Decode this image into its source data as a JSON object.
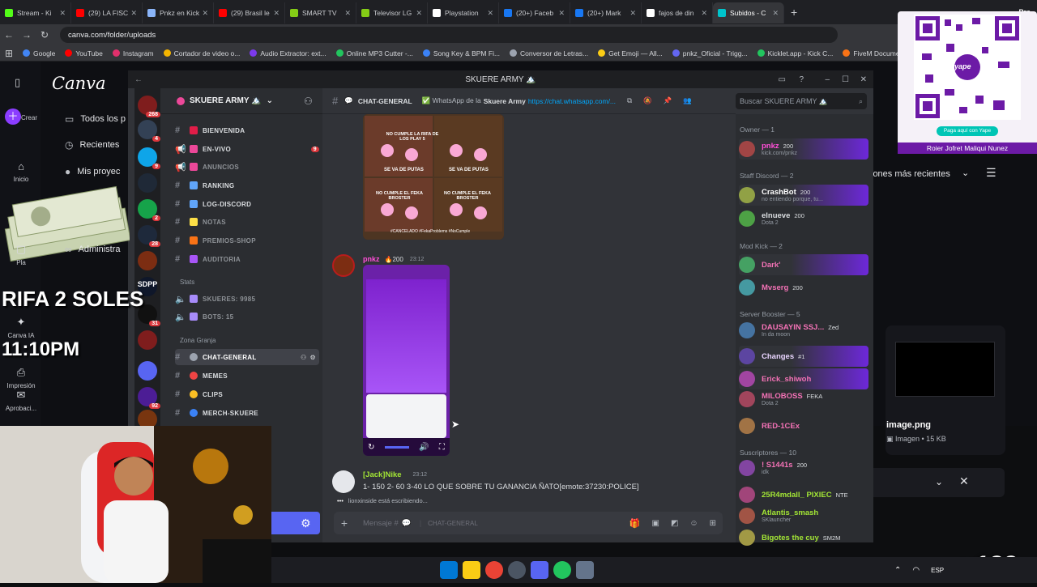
{
  "browser": {
    "tabs": [
      {
        "label": "Stream - Ki",
        "color": "#53fc18"
      },
      {
        "label": "(29) LA FISC",
        "color": "#ff0000"
      },
      {
        "label": "Pnkz en Kick",
        "color": "#8ab4f8"
      },
      {
        "label": "(29) Brasil le",
        "color": "#ff0000"
      },
      {
        "label": "SMART TV",
        "color": "#84cc16"
      },
      {
        "label": "Televisor LG",
        "color": "#84cc16"
      },
      {
        "label": "Playstation",
        "color": "#ffffff"
      },
      {
        "label": "(20+) Faceb",
        "color": "#1877f2"
      },
      {
        "label": "(20+) Mark",
        "color": "#1877f2"
      },
      {
        "label": "fajos de din",
        "color": "#ffffff"
      },
      {
        "label": "Subidos - C",
        "color": "#00c4cc",
        "active": true
      }
    ],
    "new_tab": "+",
    "profile_label": "Pre",
    "url": "canva.com/folder/uploads",
    "bookmarks": [
      {
        "label": "Google",
        "color": "#4285f4"
      },
      {
        "label": "YouTube",
        "color": "#ff0000"
      },
      {
        "label": "Instagram",
        "color": "#e1306c"
      },
      {
        "label": "Cortador de video o...",
        "color": "#f4b400"
      },
      {
        "label": "Audio Extractor: ext...",
        "color": "#7c3aed"
      },
      {
        "label": "Online MP3 Cutter -...",
        "color": "#22c55e"
      },
      {
        "label": "Song Key & BPM Fi...",
        "color": "#3b82f6"
      },
      {
        "label": "Conversor de Letras...",
        "color": "#9ca3af"
      },
      {
        "label": "Get Emoji — All...",
        "color": "#facc15"
      },
      {
        "label": "pnkz_Oficial - Trigg...",
        "color": "#6366f1"
      },
      {
        "label": "Kicklet.app - Kick C...",
        "color": "#22c55e"
      },
      {
        "label": "FiveM Documentat",
        "color": "#f97316"
      }
    ]
  },
  "canva": {
    "logo": "Canva",
    "rail": [
      {
        "label": "Crear",
        "icon": "plus-icon"
      },
      {
        "label": "Inicio",
        "icon": "home-icon"
      },
      {
        "label": "Pla",
        "icon": "folder-icon"
      },
      {
        "label": "Canva IA",
        "icon": "sparkle-icon"
      },
      {
        "label": "Impresión",
        "icon": "print-icon"
      },
      {
        "label": "Aprobaci...",
        "icon": "approval-icon"
      }
    ],
    "menu": [
      {
        "label": "Todos los p",
        "icon": "folder-icon"
      },
      {
        "label": "Recientes",
        "icon": "clock-icon"
      },
      {
        "label": "Mis proyec",
        "icon": "avatar-icon"
      },
      {
        "label": "Administra",
        "icon": "link-icon"
      }
    ],
    "sort_label": "iones más recientes",
    "file": {
      "name": "image.png",
      "meta": "Imagen • 15 KB"
    }
  },
  "overlay": {
    "rifa": "RIFA 2 SOLES",
    "clock": "11:10PM",
    "yape_cta": "Paga aquí con Yape",
    "yape_name": "Roier Jofret Maliqui Nunez",
    "counter": "x123",
    "brand": "yape"
  },
  "discord": {
    "title": "SKUERE ARMY 🏔️",
    "server_name": "SKUERE ARMY 🏔️",
    "guild_badges": [
      "268",
      "4",
      "9",
      "2",
      "28",
      "31",
      "92"
    ],
    "guild_label": "SDPP",
    "channels": [
      {
        "name": "BIENVENIDA",
        "icon": "hash",
        "emoji": "#e11d48"
      },
      {
        "name": "EN-VIVO",
        "icon": "megaphone",
        "emoji": "#ec4899",
        "badge": "9"
      },
      {
        "name": "ANUNCIOS",
        "icon": "megaphone",
        "emoji": "#ec4899",
        "dim": true
      },
      {
        "name": "RANKING",
        "icon": "hash",
        "emoji": "#60a5fa"
      },
      {
        "name": "LOG-DISCORD",
        "icon": "hash",
        "emoji": "#60a5fa"
      },
      {
        "name": "NOTAS",
        "icon": "hash",
        "emoji": "#fde047",
        "dim": true
      },
      {
        "name": "PREMIOS-SHOP",
        "icon": "hash",
        "emoji": "#f97316",
        "dim": true
      },
      {
        "name": "AUDITORIA",
        "icon": "hash",
        "emoji": "#a855f7",
        "dim": true
      }
    ],
    "stats_category": "Stats",
    "stats": [
      {
        "name": "SKUERES: 9985"
      },
      {
        "name": "BOTS: 15"
      }
    ],
    "zone_category": "Zona Granja",
    "zone_channels": [
      {
        "name": "CHAT-GENERAL",
        "active": true,
        "emoji": "#9ca3af"
      },
      {
        "name": "MEMES",
        "emoji": "#ef4444"
      },
      {
        "name": "CLIPS",
        "emoji": "#fbbf24"
      },
      {
        "name": "MERCH-SKUERE",
        "emoji": "#3b82f6"
      }
    ],
    "header": {
      "channel": "CHAT-GENERAL",
      "topic_prefix": "✅ WhatsApp de la",
      "topic_bold": "Skuere Army",
      "topic_link": "https://chat.whatsapp.com/..."
    },
    "search_placeholder": "Buscar SKUERE ARMY 🏔️",
    "meme_captions": [
      "NO CUMPLE LA RIFA DE LOS PLAY 5",
      "SE VA DE PUTAS",
      "SE VA DE PUTAS",
      "NO CUMPLE EL FEKA BROSTER",
      "NO CUMPLE EL FEKA BROSTER",
      "#CANCELADO #FekaProblems #NoCumple"
    ],
    "messages": [
      {
        "author": "pnkz",
        "badge": "200",
        "time": "23:12"
      },
      {
        "author": "[Jack]Nike",
        "time": "23:12",
        "text": "1- 150 2- 60 3-40 LO QUE SOBRE TU GANANCIA ÑATO[emote:37230:POLICE]"
      }
    ],
    "typing": "lionxinside está escribiendo...",
    "input_placeholder": "Mensaje #",
    "input_channel": "CHAT-GENERAL",
    "member_groups": [
      {
        "title": "Owner — 1",
        "members": [
          {
            "name": "pnkz",
            "sub": "kick.com/pnkz",
            "color": "#ff4fd8",
            "tag": "200",
            "hl": true
          }
        ]
      },
      {
        "title": "Staff Discord — 2",
        "members": [
          {
            "name": "CrashBot",
            "sub": "no entiendo porque, tu...",
            "color": "#ffffff",
            "tag": "200",
            "hl": true
          },
          {
            "name": "elnueve",
            "sub": "Dota 2",
            "color": "#dbdee1",
            "tag": "200"
          }
        ]
      },
      {
        "title": "Mod Kick — 2",
        "members": [
          {
            "name": "Dark'",
            "sub": "",
            "color": "#f472b6",
            "hl": true
          },
          {
            "name": "Mvserg",
            "sub": "",
            "color": "#f472b6",
            "tag": "200"
          }
        ]
      },
      {
        "title": "Server Booster — 5",
        "members": [
          {
            "name": "DAUSAYIN SSJ...",
            "sub": "In da moon",
            "color": "#f472b6",
            "tag": "Zed"
          },
          {
            "name": "Changes",
            "sub": "",
            "color": "#e9d5ff",
            "tag": "#1",
            "hl": true
          },
          {
            "name": "Erick_shiwoh",
            "sub": "",
            "color": "#f472b6",
            "hl": true
          },
          {
            "name": "MILOBOSS",
            "sub": "Dota 2",
            "color": "#f472b6",
            "tag": "FEKA"
          },
          {
            "name": "RED-1CEx",
            "sub": "",
            "color": "#f472b6"
          }
        ]
      },
      {
        "title": "Suscriptores — 10",
        "members": [
          {
            "name": "! S1441s",
            "sub": "idk",
            "color": "#f472b6",
            "tag": "200"
          },
          {
            "name": "25R4mdall_ PIXIEC",
            "sub": "",
            "color": "#a3e635",
            "tag": "NTE"
          },
          {
            "name": "Atlantis_smash",
            "sub": "SKlauncher",
            "color": "#a3e635"
          },
          {
            "name": "Bigotes the cuy",
            "sub": "",
            "color": "#a3e635",
            "tag": "SM2M"
          }
        ]
      }
    ]
  },
  "taskbar": {
    "lang": "ESP"
  }
}
